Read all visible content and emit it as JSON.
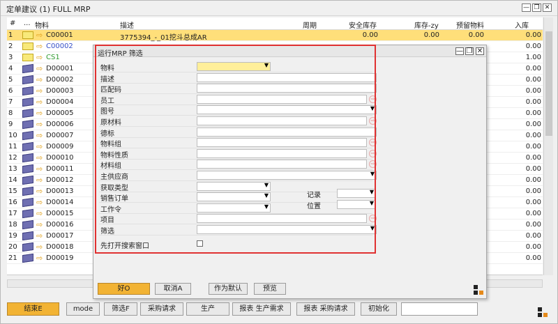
{
  "window": {
    "title": "定单建议 (1) FULL MRP",
    "minimize": "—",
    "restore": "❐",
    "close": "✕"
  },
  "grid": {
    "headers": [
      "#",
      "...",
      "物料",
      "描述",
      "周期",
      "安全库存",
      "库存-zy",
      "预留物料",
      "入库"
    ],
    "rows": [
      {
        "n": "1",
        "icon": "folder-icon",
        "code": "C00001",
        "color": "",
        "desc": "3775394_-_01挖斗总成AR",
        "safety": "0.00",
        "stock": "0.00",
        "reserved": "0.00",
        "inbound": "0.00",
        "selected": true
      },
      {
        "n": "2",
        "icon": "folder-icon",
        "code": "C00002",
        "color": "blue",
        "desc": "",
        "safety": "",
        "stock": "",
        "reserved": "",
        "inbound": "0.00"
      },
      {
        "n": "3",
        "icon": "folder-icon",
        "code": "CS1",
        "color": "green",
        "desc": "",
        "safety": "",
        "stock": "",
        "reserved": "",
        "inbound": "1.00"
      },
      {
        "n": "4",
        "icon": "cube-icon",
        "code": "D00001",
        "color": "",
        "desc": "",
        "safety": "",
        "stock": "",
        "reserved": "",
        "inbound": "0.00"
      },
      {
        "n": "5",
        "icon": "cube-icon",
        "code": "D00002",
        "color": "",
        "desc": "",
        "safety": "",
        "stock": "",
        "reserved": "",
        "inbound": "0.00"
      },
      {
        "n": "6",
        "icon": "cube-icon",
        "code": "D00003",
        "color": "",
        "desc": "",
        "safety": "",
        "stock": "",
        "reserved": "",
        "inbound": "0.00"
      },
      {
        "n": "7",
        "icon": "cube-icon",
        "code": "D00004",
        "color": "",
        "desc": "",
        "safety": "",
        "stock": "",
        "reserved": "",
        "inbound": "0.00"
      },
      {
        "n": "8",
        "icon": "cube-icon",
        "code": "D00005",
        "color": "",
        "desc": "",
        "safety": "",
        "stock": "",
        "reserved": "",
        "inbound": "0.00"
      },
      {
        "n": "9",
        "icon": "cube-icon",
        "code": "D00006",
        "color": "",
        "desc": "",
        "safety": "",
        "stock": "",
        "reserved": "",
        "inbound": "0.00"
      },
      {
        "n": "10",
        "icon": "cube-icon",
        "code": "D00007",
        "color": "",
        "desc": "",
        "safety": "",
        "stock": "",
        "reserved": "",
        "inbound": "0.00"
      },
      {
        "n": "11",
        "icon": "cube-icon",
        "code": "D00009",
        "color": "",
        "desc": "",
        "safety": "",
        "stock": "",
        "reserved": "",
        "inbound": "0.00"
      },
      {
        "n": "12",
        "icon": "cube-icon",
        "code": "D00010",
        "color": "",
        "desc": "",
        "safety": "",
        "stock": "",
        "reserved": "",
        "inbound": "0.00"
      },
      {
        "n": "13",
        "icon": "cube-icon",
        "code": "D00011",
        "color": "",
        "desc": "",
        "safety": "",
        "stock": "",
        "reserved": "",
        "inbound": "0.00"
      },
      {
        "n": "14",
        "icon": "cube-icon",
        "code": "D00012",
        "color": "",
        "desc": "",
        "safety": "",
        "stock": "",
        "reserved": "",
        "inbound": "0.00"
      },
      {
        "n": "15",
        "icon": "cube-icon",
        "code": "D00013",
        "color": "",
        "desc": "",
        "safety": "",
        "stock": "",
        "reserved": "",
        "inbound": "0.00"
      },
      {
        "n": "16",
        "icon": "cube-icon",
        "code": "D00014",
        "color": "",
        "desc": "",
        "safety": "",
        "stock": "",
        "reserved": "",
        "inbound": "0.00"
      },
      {
        "n": "17",
        "icon": "cube-icon",
        "code": "D00015",
        "color": "",
        "desc": "",
        "safety": "",
        "stock": "",
        "reserved": "",
        "inbound": "0.00"
      },
      {
        "n": "18",
        "icon": "cube-icon",
        "code": "D00016",
        "color": "",
        "desc": "",
        "safety": "",
        "stock": "",
        "reserved": "",
        "inbound": "0.00"
      },
      {
        "n": "19",
        "icon": "cube-icon",
        "code": "D00017",
        "color": "",
        "desc": "",
        "safety": "",
        "stock": "",
        "reserved": "",
        "inbound": "0.00"
      },
      {
        "n": "20",
        "icon": "cube-icon",
        "code": "D00018",
        "color": "",
        "desc": "",
        "safety": "",
        "stock": "",
        "reserved": "",
        "inbound": "0.00"
      },
      {
        "n": "21",
        "icon": "cube-icon",
        "code": "D00019",
        "color": "",
        "desc": "",
        "safety": "",
        "stock": "",
        "reserved": "",
        "inbound": "0.00"
      }
    ]
  },
  "dialog": {
    "title": "运行MRP 筛选",
    "fields": [
      "物料",
      "描述",
      "匹配码",
      "员工",
      "图号",
      "原材料",
      "德标",
      "物料组",
      "物料性质",
      "材料组",
      "主供应商",
      "获取类型",
      "销售订单",
      "工作令",
      "项目",
      "筛选"
    ],
    "record_label": "记录",
    "position_label": "位置",
    "open_search_label": "先打开搜索窗口",
    "ok": "好O",
    "cancel": "取消A",
    "default": "作为默认",
    "preview": "预览"
  },
  "toolbar": {
    "end": "结束E",
    "mode": "mode",
    "filter": "筛选F",
    "purchase_request": "采购请求",
    "production": "生产",
    "report_production": "报表 生产需求",
    "report_purchase": "报表 采购请求",
    "init": "初始化"
  },
  "colors": {
    "selected_row": "#ffdf7a",
    "main_button": "#f2b334",
    "highlight_border": "#e03131"
  }
}
